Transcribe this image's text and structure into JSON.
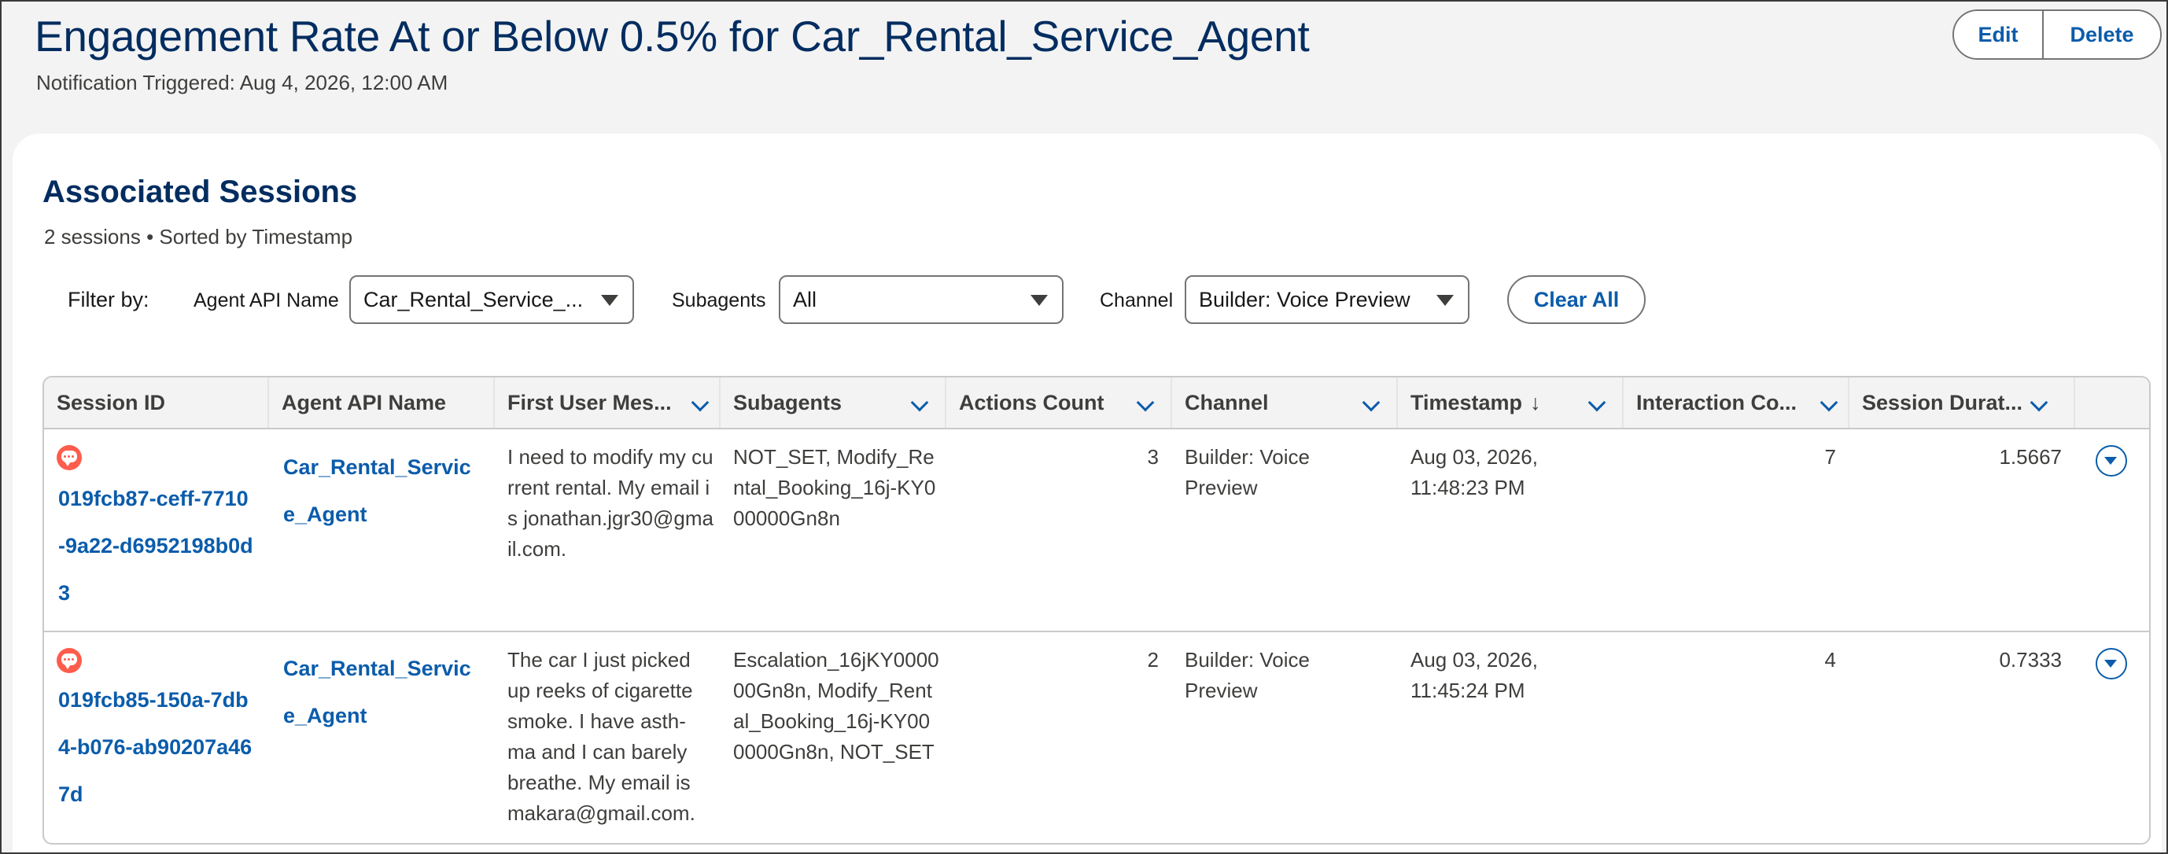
{
  "header": {
    "title": "Engagement Rate At or Below 0.5% for Car_Rental_Service_Agent",
    "subtitle": "Notification Triggered: Aug 4, 2026, 12:00 AM",
    "edit_label": "Edit",
    "delete_label": "Delete"
  },
  "sessions": {
    "title": "Associated Sessions",
    "meta": "2 sessions • Sorted by Timestamp"
  },
  "filters": {
    "label": "Filter by:",
    "agent_api_name": {
      "label": "Agent API Name",
      "value": "Car_Rental_Service_..."
    },
    "subagents": {
      "label": "Subagents",
      "value": "All"
    },
    "channel": {
      "label": "Channel",
      "value": "Builder: Voice Preview"
    },
    "clear_all_label": "Clear All"
  },
  "table": {
    "columns": [
      "Session ID",
      "Agent API Name",
      "First User Mes...",
      "Subagents",
      "Actions Count",
      "Channel",
      "Timestamp",
      "Interaction Co...",
      "Session Durat..."
    ],
    "sort_indicator": "↓",
    "rows": [
      {
        "session_id": "019fcb87-ceff-7710-9a22-d6952198b0d3",
        "agent_api_name": "Car_Rental_Service_Agent",
        "first_user_message": "I need to modify my current rental. My email is jonathan.jgr30@gmail.com.",
        "subagents": "NOT_SET, Modify_Rental_Booking_16j-KY000000Gn8n",
        "actions_count": "3",
        "channel": "Builder: Voice Preview",
        "timestamp": "Aug 03, 2026, 11:48:23 PM",
        "interaction_count": "7",
        "session_duration": "1.5667"
      },
      {
        "session_id": "019fcb85-150a-7db4-b076-ab90207a467d",
        "agent_api_name": "Car_Rental_Service_Agent",
        "first_user_message": "The car I just picked up reeks of cigarette smoke. I have asth-ma and I can barely breathe. My email is makara@gmail.com.",
        "subagents": "Escalation_16jKY000000Gn8n, Modify_Rental_Booking_16j-KY000000Gn8n, NOT_SET",
        "actions_count": "2",
        "channel": "Builder: Voice Preview",
        "timestamp": "Aug 03, 2026, 11:45:24 PM",
        "interaction_count": "4",
        "session_duration": "0.7333"
      }
    ]
  }
}
